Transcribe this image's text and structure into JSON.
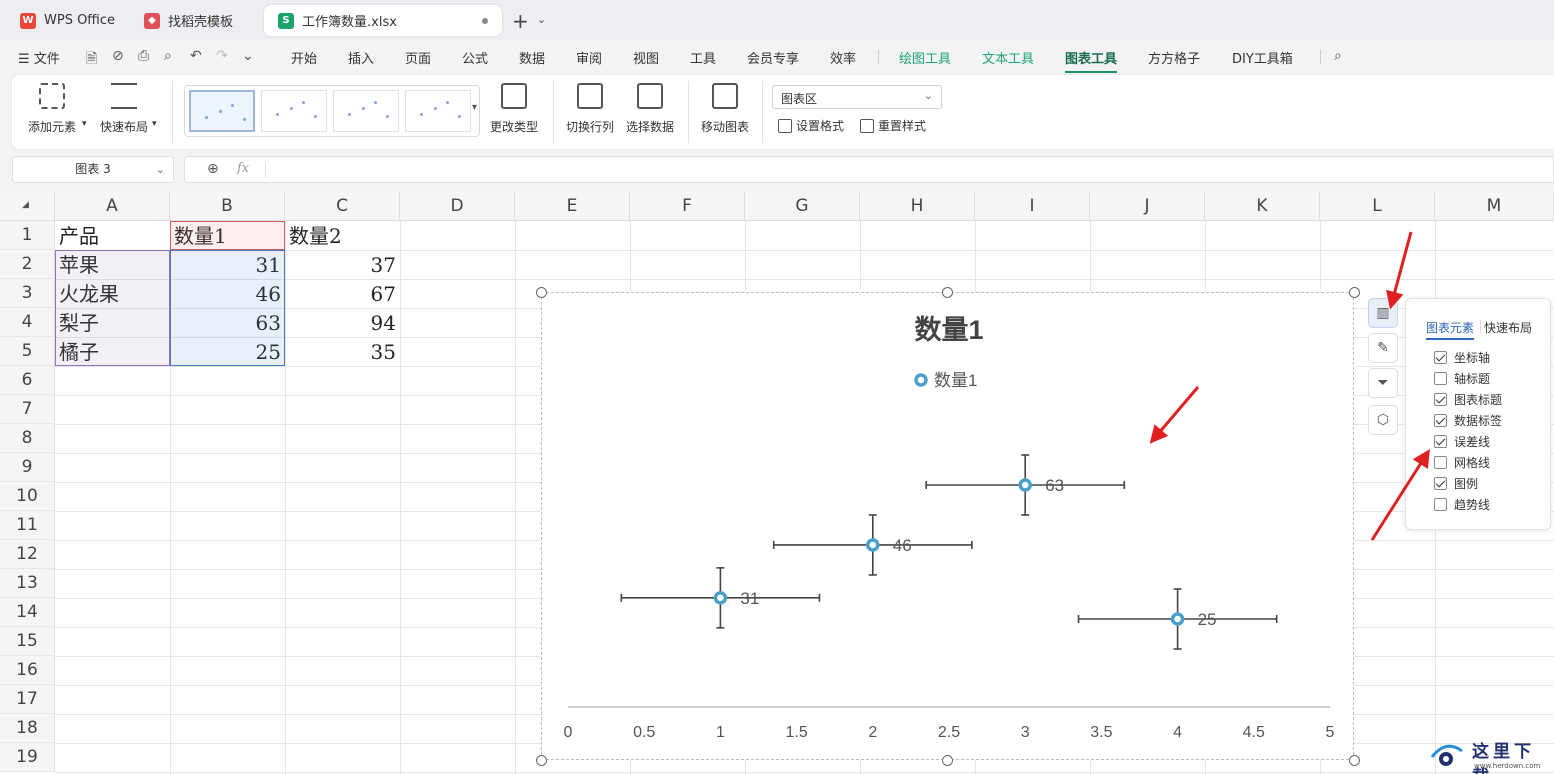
{
  "tabs": [
    {
      "label": "WPS Office",
      "icon": "wps-logo-icon"
    },
    {
      "label": "找稻壳模板",
      "icon": "daoke-icon"
    },
    {
      "label": "工作簿数量.xlsx",
      "icon": "spreadsheet-icon",
      "active": true
    }
  ],
  "menu": {
    "file_label": "文件",
    "items": [
      "开始",
      "插入",
      "页面",
      "公式",
      "数据",
      "审阅",
      "视图",
      "工具",
      "会员专享",
      "效率"
    ],
    "tool_items": [
      "绘图工具",
      "文本工具",
      "图表工具",
      "方方格子",
      "DIY工具箱"
    ],
    "active": "图表工具"
  },
  "ribbon": {
    "add_element": "添加元素",
    "quick_layout": "快速布局",
    "change_type": "更改类型",
    "switch_row_col": "切换行列",
    "select_data": "选择数据",
    "move_chart": "移动图表",
    "area_select": "图表区",
    "set_format": "设置格式",
    "reset_style": "重置样式"
  },
  "formula_bar": {
    "name_box": "图表 3",
    "fx": "fx",
    "value": ""
  },
  "grid": {
    "columns": [
      "A",
      "B",
      "C",
      "D",
      "E",
      "F",
      "G",
      "H",
      "I",
      "J",
      "K",
      "L",
      "M"
    ],
    "rows": [
      "1",
      "2",
      "3",
      "4",
      "5",
      "6",
      "7",
      "8",
      "9",
      "10",
      "11",
      "12",
      "13",
      "14",
      "15",
      "16",
      "17",
      "18",
      "19"
    ],
    "header": [
      "产品",
      "数量1",
      "数量2"
    ],
    "data": [
      [
        "苹果",
        "31",
        "37"
      ],
      [
        "火龙果",
        "46",
        "67"
      ],
      [
        "梨子",
        "63",
        "94"
      ],
      [
        "橘子",
        "25",
        "35"
      ]
    ]
  },
  "chart_data": {
    "type": "scatter",
    "title": "数量1",
    "legend": "top-center",
    "series": [
      {
        "name": "数量1",
        "x": [
          1,
          2,
          3,
          4
        ],
        "y": [
          31,
          46,
          63,
          25
        ],
        "labels": [
          "31",
          "46",
          "63",
          "25"
        ]
      }
    ],
    "x_ticks": [
      "0",
      "0.5",
      "1",
      "1.5",
      "2",
      "2.5",
      "3",
      "3.5",
      "4",
      "4.5",
      "5"
    ],
    "xlim": [
      0,
      5
    ],
    "x_error": 0.65,
    "y_error": 10,
    "grid": false,
    "marker_color": "#4a9fc9"
  },
  "panel": {
    "tabs": [
      "图表元素",
      "快速布局"
    ],
    "options": [
      {
        "label": "坐标轴",
        "checked": true
      },
      {
        "label": "轴标题",
        "checked": false
      },
      {
        "label": "图表标题",
        "checked": true
      },
      {
        "label": "数据标签",
        "checked": true
      },
      {
        "label": "误差线",
        "checked": true
      },
      {
        "label": "网格线",
        "checked": false
      },
      {
        "label": "图例",
        "checked": true
      },
      {
        "label": "趋势线",
        "checked": false
      }
    ]
  },
  "watermark": {
    "text": "这里下载",
    "url": "www.herdown.com"
  },
  "colors": {
    "accent": "#1b8f66",
    "annotation_arrow": "#e02020",
    "marker": "#4a9fc9"
  }
}
